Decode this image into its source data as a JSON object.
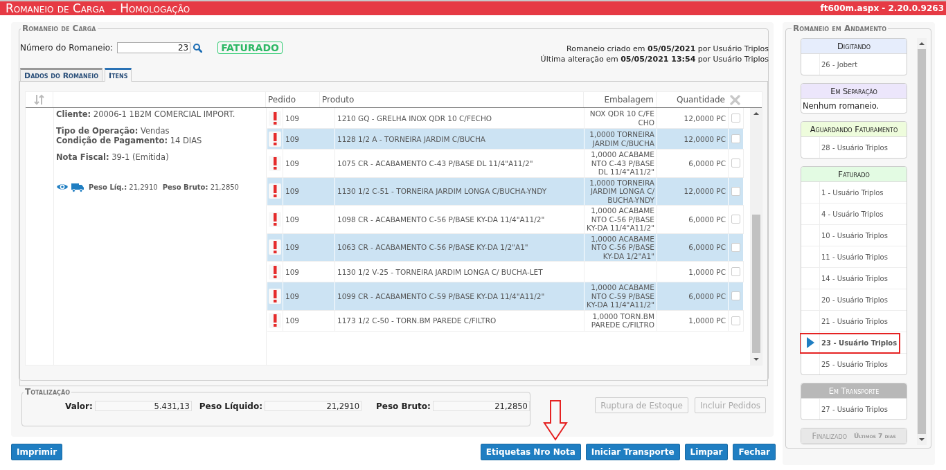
{
  "title_bar": {
    "title": "Romaneio de Carga  - Homologação",
    "version": "ft600m.aspx - 2.20.0.9263"
  },
  "romaneio": {
    "legend": "Romaneio de Carga",
    "number_label": "Número do Romaneio:",
    "number_value": "23",
    "status": "FATURADO",
    "created": "Romaneio criado em **05/05/2021** por Usuário Triplos",
    "modified": "Última alteração em **05/05/2021 13:54** por Usuário Triplos"
  },
  "tabs": [
    {
      "label": "Dados do Romaneio",
      "selected": false
    },
    {
      "label": "Itens",
      "selected": true
    }
  ],
  "summary": {
    "sections": [
      [
        "**Cliente:** 20006-1 1B2M COMERCIAL IMPORT."
      ],
      [
        "**Tipo de Operação:** Vendas",
        "**Condição de Pagamento:** 14 DIAS"
      ],
      [
        "**Nota Fiscal:** 39-1 (Emitida)"
      ]
    ],
    "weights": [
      "**Peso Líq.:** 21,2910",
      "**Peso Bruto:** 21,2850"
    ]
  },
  "table": {
    "columns": [
      "Pedido",
      "Produto",
      "Embalagem",
      "Quantidade"
    ],
    "rows": [
      {
        "pedido": "109",
        "produto": "1210 GQ - GRELHA INOX QDR 10 C/FECHO",
        "embalagem": "NOX QDR 10 C/FE CHO",
        "quantidade": "12,0000 PC",
        "checked": false
      },
      {
        "pedido": "109",
        "produto": "1128 1/2 A - TORNEIRA JARDIM C/BUCHA",
        "embalagem": "1,0000 TORNEIRA JARDIM C/BUCHA",
        "quantidade": "12,0000 PC",
        "checked": false
      },
      {
        "pedido": "109",
        "produto": "1075 CR - ACABAMENTO C-43 P/BASE DL 11/4\"A11/2\"",
        "embalagem": "1,0000 ACABAMENTO C-43 P/BASE DL 11/4\"A11/2\"",
        "quantidade": "6,0000 PC",
        "checked": false
      },
      {
        "pedido": "109",
        "produto": "1130 1/2 C-51 - TORNEIRA JARDIM LONGA C/BUCHA-YNDY",
        "embalagem": "1,0000 TORNEIRA JARDIM LONGA C/BUCHA-YNDY",
        "quantidade": "12,0000 PC",
        "checked": false
      },
      {
        "pedido": "109",
        "produto": "1098 CR - ACABAMENTO C-56 P/BASE KY-DA 11/4\"A11/2\"",
        "embalagem": "1,0000 ACABAMENTO C-56 P/BASE KY-DA 11/4\"A11/2\"",
        "quantidade": "6,0000 PC",
        "checked": false
      },
      {
        "pedido": "109",
        "produto": "1063 CR - ACABAMENTO C-56 P/BASE KY-DA 1/2\"A1\"",
        "embalagem": "1,0000 ACABAMENTO C-56 P/BASE KY-DA 1/2\"A1\"",
        "quantidade": "6,0000 PC",
        "checked": false
      },
      {
        "pedido": "109",
        "produto": "1130 1/2 V-25 - TORNEIRA JARDIM LONGA C/ BUCHA-LET",
        "quantidade": "1,0000 PC",
        "checked": false
      },
      {
        "pedido": "109",
        "produto": "1099 CR - ACABAMENTO C-59 P/BASE KY-DA 11/4\"A11/2\"",
        "embalagem": "1,0000 ACABAMENTO C-59 P/BASE KY-DA 11/4\"A11/2\"",
        "quantidade": "6,0000 PC",
        "checked": false
      },
      {
        "pedido": "109",
        "produto": "1173 1/2 C-50 - TORN.BM PAREDE C/FILTRO",
        "embalagem": "1,0000 TORN.BM PAREDE C/FILTRO",
        "quantidade": "1,0000 PC",
        "checked": false
      }
    ]
  },
  "grid_actions": [
    {
      "label": "Ruptura de Estoque",
      "disabled": true
    },
    {
      "label": "Incluir Pedidos",
      "disabled": true
    }
  ],
  "totals": {
    "legend": "Totalização",
    "fields": [
      {
        "label": "Valor:",
        "value": "5.431,13"
      },
      {
        "label": "Peso Líquido:",
        "value": "21,2910"
      },
      {
        "label": "Peso Bruto:",
        "value": "21,2850"
      }
    ]
  },
  "left_buttons": [
    {
      "label": "Imprimir",
      "disabled": false
    }
  ],
  "right_buttons": [
    {
      "label": "Etiquetas Nro Nota",
      "disabled": false
    },
    {
      "label": "Iniciar Transporte",
      "disabled": false
    },
    {
      "label": "Limpar",
      "disabled": false
    },
    {
      "label": "Fechar",
      "disabled": false
    }
  ],
  "side_panel": {
    "legend": "Romaneio em Andamento",
    "groups": [
      {
        "title": "Digitando",
        "color": "#e6edfc",
        "disabled": false,
        "items": [
          {
            "label": "26 - Jobert",
            "selected": false
          }
        ]
      },
      {
        "title": "Em Separação",
        "color": "#ece6fb",
        "disabled": false,
        "empty_text": "Nenhum romaneio."
      },
      {
        "title": "Aguardando Faturamento",
        "color": "#eefcdc",
        "disabled": false,
        "items": [
          {
            "label": "28 - Usuário Triplos",
            "selected": false
          }
        ]
      },
      {
        "title": "Faturado",
        "color": "#e3fbe3",
        "disabled": false,
        "items": [
          {
            "label": "1 - Usuário Triplos",
            "selected": false
          },
          {
            "label": "4 - Usuário Triplos",
            "selected": false
          },
          {
            "label": "10 - Usuário Triplos",
            "selected": false
          },
          {
            "label": "11 - Usuário Triplos",
            "selected": false
          },
          {
            "label": "14 - Usuário Triplos",
            "selected": false
          },
          {
            "label": "20 - Usuário Triplos",
            "selected": false
          },
          {
            "label": "21 - Usuário Triplos",
            "selected": false
          },
          {
            "label": "23 - Usuário Triplos",
            "selected": true
          },
          {
            "label": "25 - Usuário Triplos",
            "selected": false
          }
        ]
      },
      {
        "title": "Em Transporte",
        "color": "#b8b8b8",
        "disabled": false,
        "items": [
          {
            "label": "27 - Usuário Triplos",
            "selected": false
          }
        ]
      },
      {
        "title": "Finalizado",
        "subtitle": "Últimos 7 dias",
        "color": "#e8e8e8",
        "disabled": true
      }
    ]
  }
}
